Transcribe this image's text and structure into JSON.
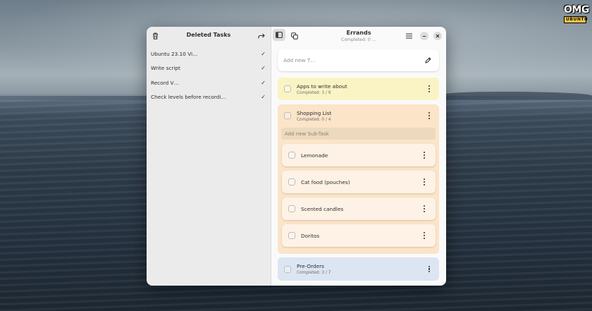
{
  "logo": {
    "top": "OMG",
    "bottom": "UBUNTU"
  },
  "sidebar": {
    "title": "Deleted Tasks",
    "items": [
      {
        "label": "Ubuntu 23.10 Vi…"
      },
      {
        "label": "Write script"
      },
      {
        "label": "Record V…"
      },
      {
        "label": "Check levels before recordi…"
      }
    ]
  },
  "header": {
    "title": "Errands",
    "subtitle": "Completed: 0 …"
  },
  "add_task": {
    "placeholder": "Add new T…"
  },
  "tasks": [
    {
      "title": "Apps to write about",
      "meta": "Completed: 3 / 9",
      "color": "#faf4c4"
    },
    {
      "title": "Shopping List",
      "meta": "Completed: 0 / 4",
      "color": "#fbe4c8",
      "subtask_placeholder": "Add new Sub-Task",
      "subtasks": [
        {
          "label": "Lemonade"
        },
        {
          "label": "Cat food (pouches)"
        },
        {
          "label": "Scented candles"
        },
        {
          "label": "Doritos"
        }
      ]
    },
    {
      "title": "Pre-Orders",
      "meta": "Completed: 3 / 7",
      "color": "#dce5f2"
    }
  ],
  "icons": [
    "trash-icon",
    "redo-icon",
    "sidebar-toggle-icon",
    "duplicate-icon",
    "hamburger-menu-icon",
    "minimize-icon",
    "close-icon",
    "pencil-icon",
    "kebab-menu-icon",
    "checkmark-icon"
  ]
}
